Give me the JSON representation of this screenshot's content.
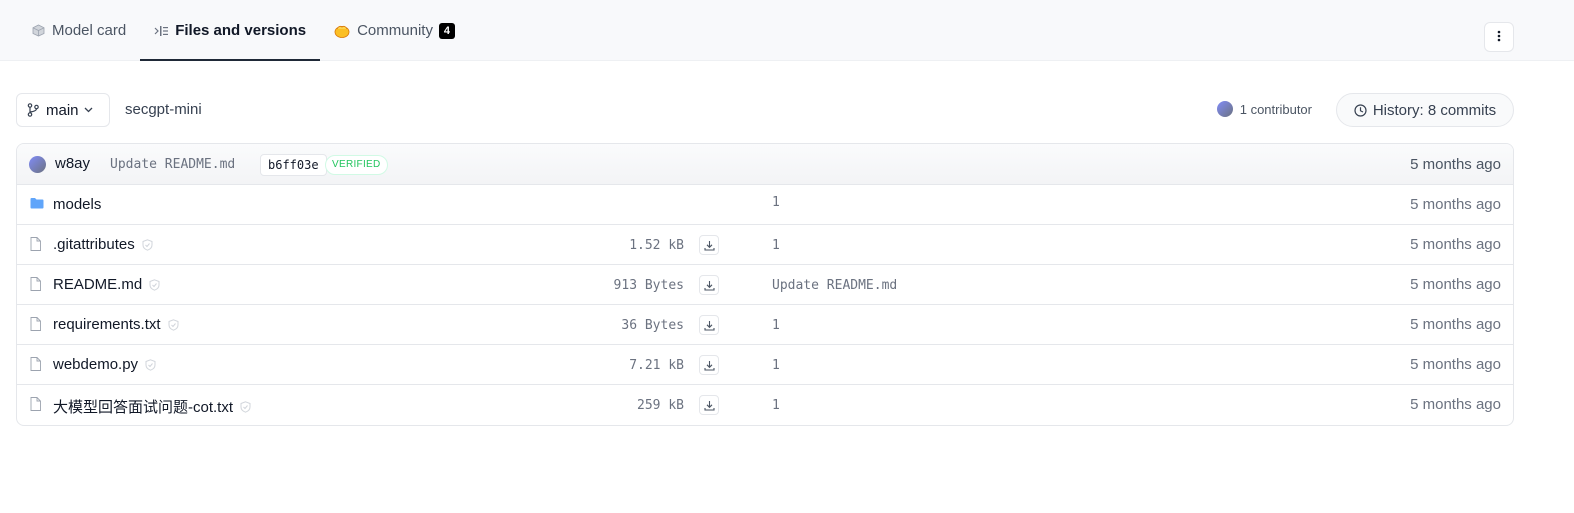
{
  "tabs": [
    {
      "label": "Model card",
      "icon": "cube-icon",
      "active": false
    },
    {
      "label": "Files and versions",
      "icon": "files-icon",
      "active": true
    },
    {
      "label": "Community",
      "icon": "hand-icon",
      "badge": "4",
      "active": false
    }
  ],
  "branch": {
    "label": "main"
  },
  "repo_path": "secgpt-mini",
  "contributors": {
    "label": "1 contributor"
  },
  "history": {
    "label": "History: 8 commits"
  },
  "last_commit": {
    "author": "w8ay",
    "message": "Update README.md",
    "hash": "b6ff03e",
    "verified": "VERIFIED",
    "time": "5 months ago"
  },
  "files": [
    {
      "type": "folder",
      "name": "models",
      "size": "",
      "message": "1",
      "time": "5 months ago"
    },
    {
      "type": "file",
      "name": ".gitattributes",
      "size": "1.52 kB",
      "message": "1",
      "time": "5 months ago"
    },
    {
      "type": "file",
      "name": "README.md",
      "size": "913 Bytes",
      "message": "Update README.md",
      "time": "5 months ago"
    },
    {
      "type": "file",
      "name": "requirements.txt",
      "size": "36 Bytes",
      "message": "1",
      "time": "5 months ago"
    },
    {
      "type": "file",
      "name": "webdemo.py",
      "size": "7.21 kB",
      "message": "1",
      "time": "5 months ago"
    },
    {
      "type": "file",
      "name": "大模型回答面试问题-cot.txt",
      "size": "259 kB",
      "message": "1",
      "time": "5 months ago"
    }
  ],
  "colors": {
    "accent": "#1f2937",
    "folder": "#60a5fa",
    "verified": "#22c55e",
    "badge_bg": "#000000"
  }
}
